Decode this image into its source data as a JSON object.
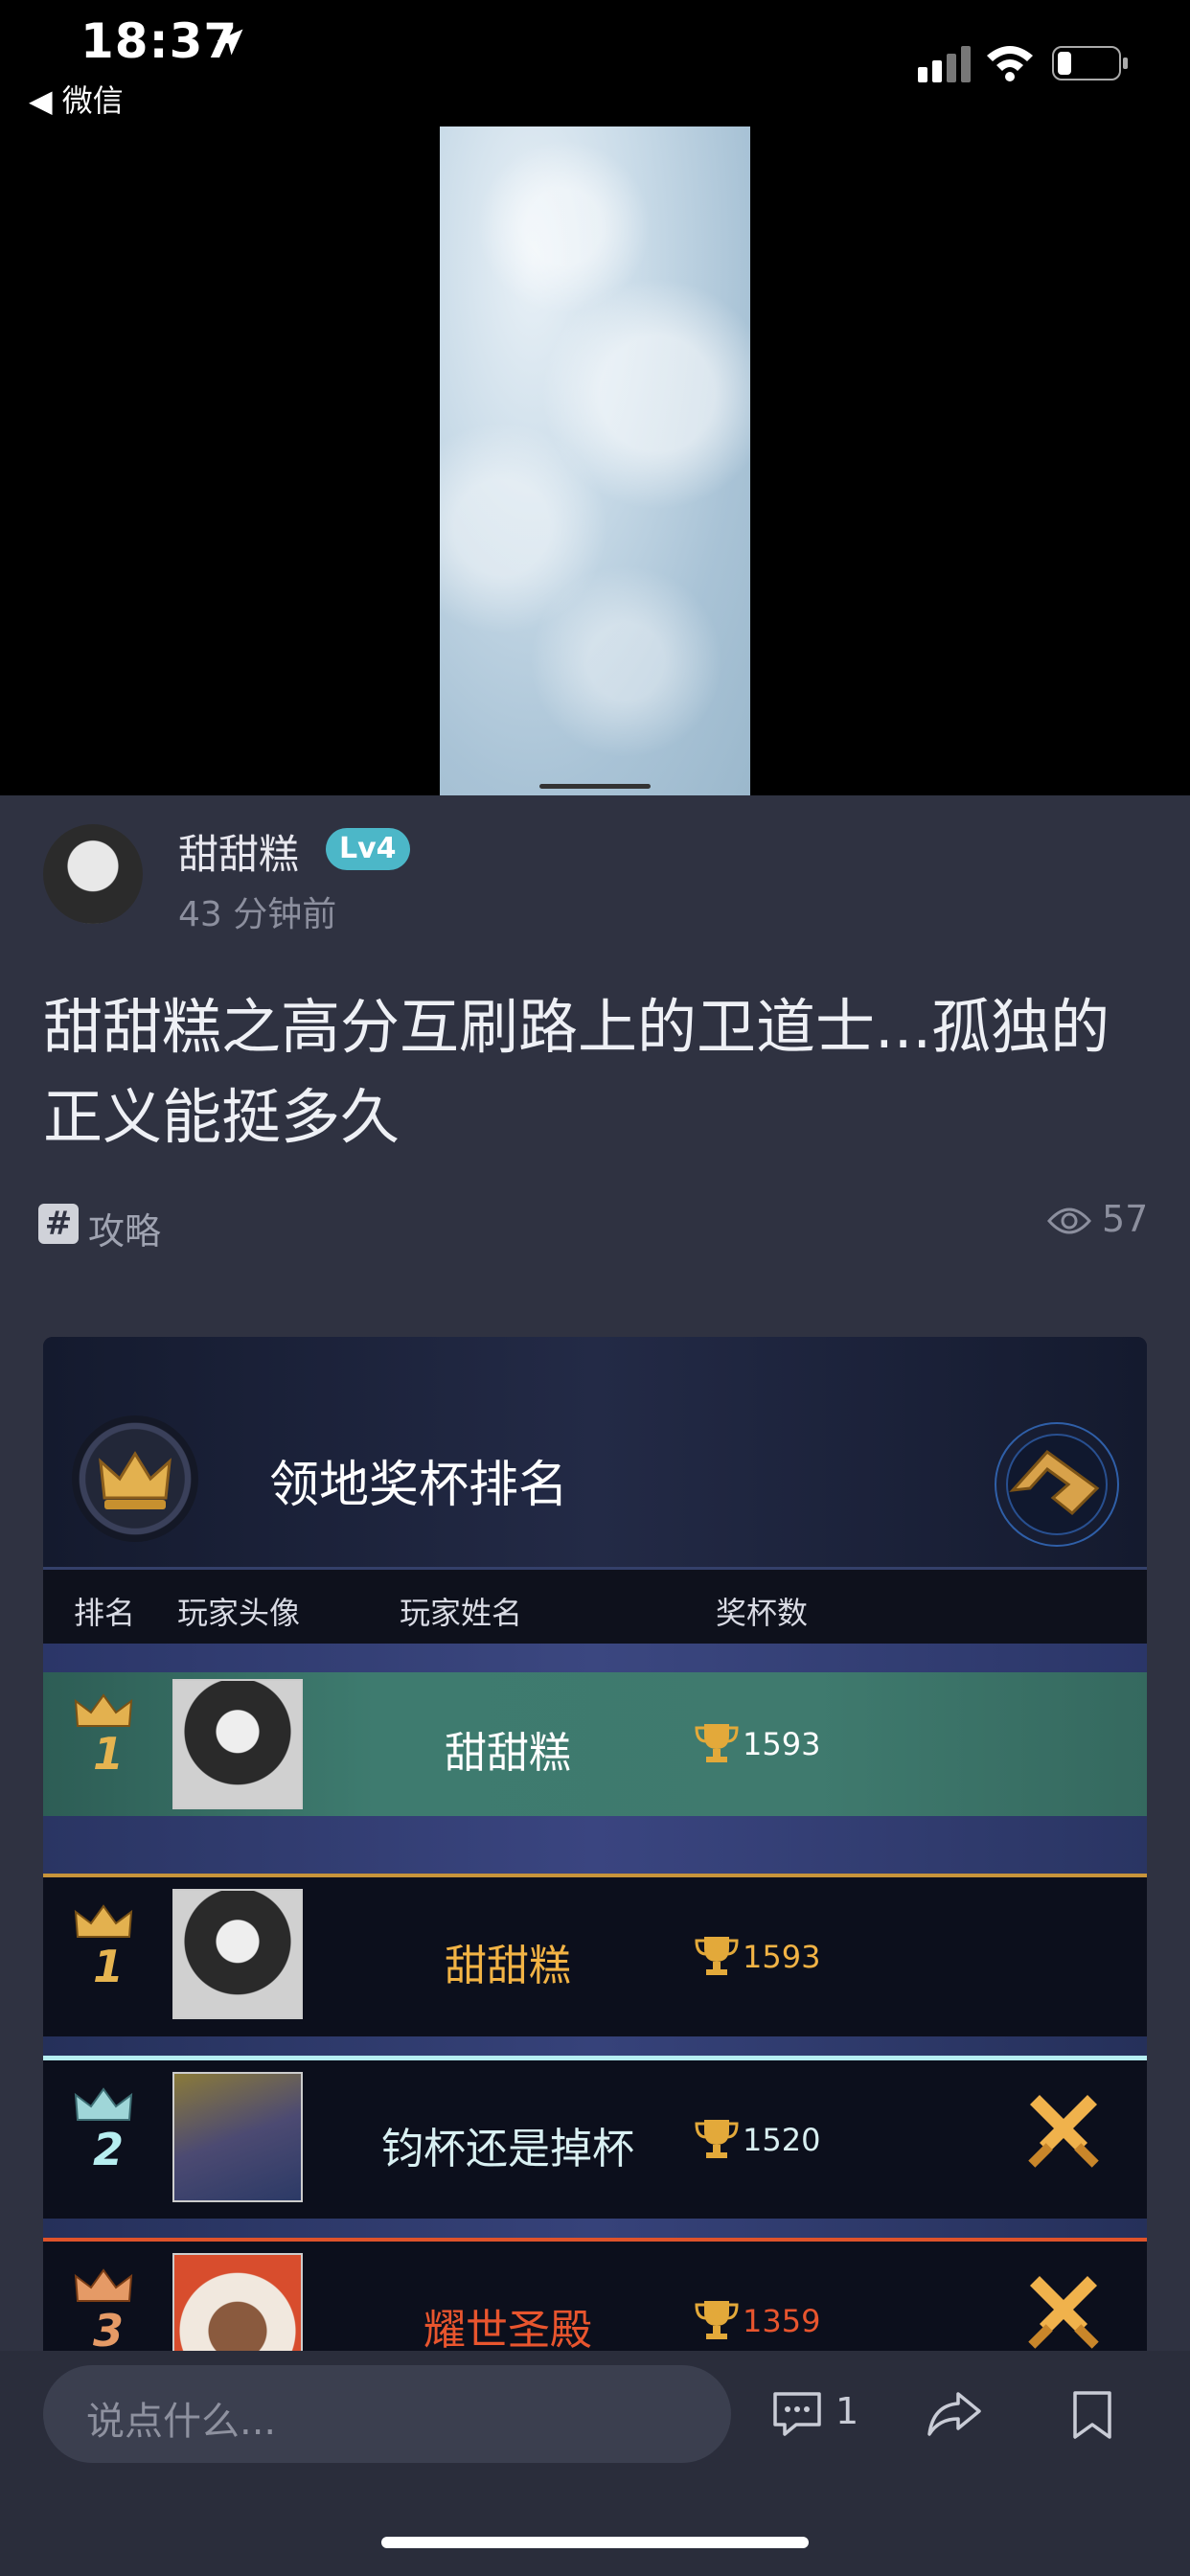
{
  "status_bar": {
    "time": "18:37",
    "back_label": "◀ 微信"
  },
  "author": {
    "name": "甜甜糕",
    "level": "Lv4",
    "time_ago": "43 分钟前"
  },
  "post": {
    "title": "甜甜糕之高分互刷路上的卫道士...孤独的正义能挺多久",
    "tag_icon": "#",
    "tag": "攻略",
    "views": "57"
  },
  "game_image": {
    "title": "领地奖杯排名",
    "columns": [
      "排名",
      "玩家头像",
      "玩家姓名",
      "奖杯数"
    ],
    "rows": [
      {
        "rank": "1",
        "name": "甜甜糕",
        "score": "1593",
        "crown": "gold",
        "name_color": "#ffffff",
        "score_color": "#ffffff"
      },
      {
        "rank": "1",
        "name": "甜甜糕",
        "score": "1593",
        "crown": "gold",
        "name_color": "#f2b345",
        "score_color": "#f2b345"
      },
      {
        "rank": "2",
        "name": "钧杯还是掉杯",
        "score": "1520",
        "crown": "silver",
        "name_color": "#d9f0f2",
        "score_color": "#d9f0f2"
      },
      {
        "rank": "3",
        "name": "耀世圣殿",
        "score": "1359",
        "crown": "bronze",
        "name_color": "#e8552e",
        "score_color": "#e8552e"
      }
    ]
  },
  "bottom_bar": {
    "comment_placeholder": "说点什么...",
    "comment_count": "1"
  },
  "colors": {
    "background": "#2f3241",
    "level_badge": "#4cb7c8",
    "self_row": "#3e7b6f"
  }
}
